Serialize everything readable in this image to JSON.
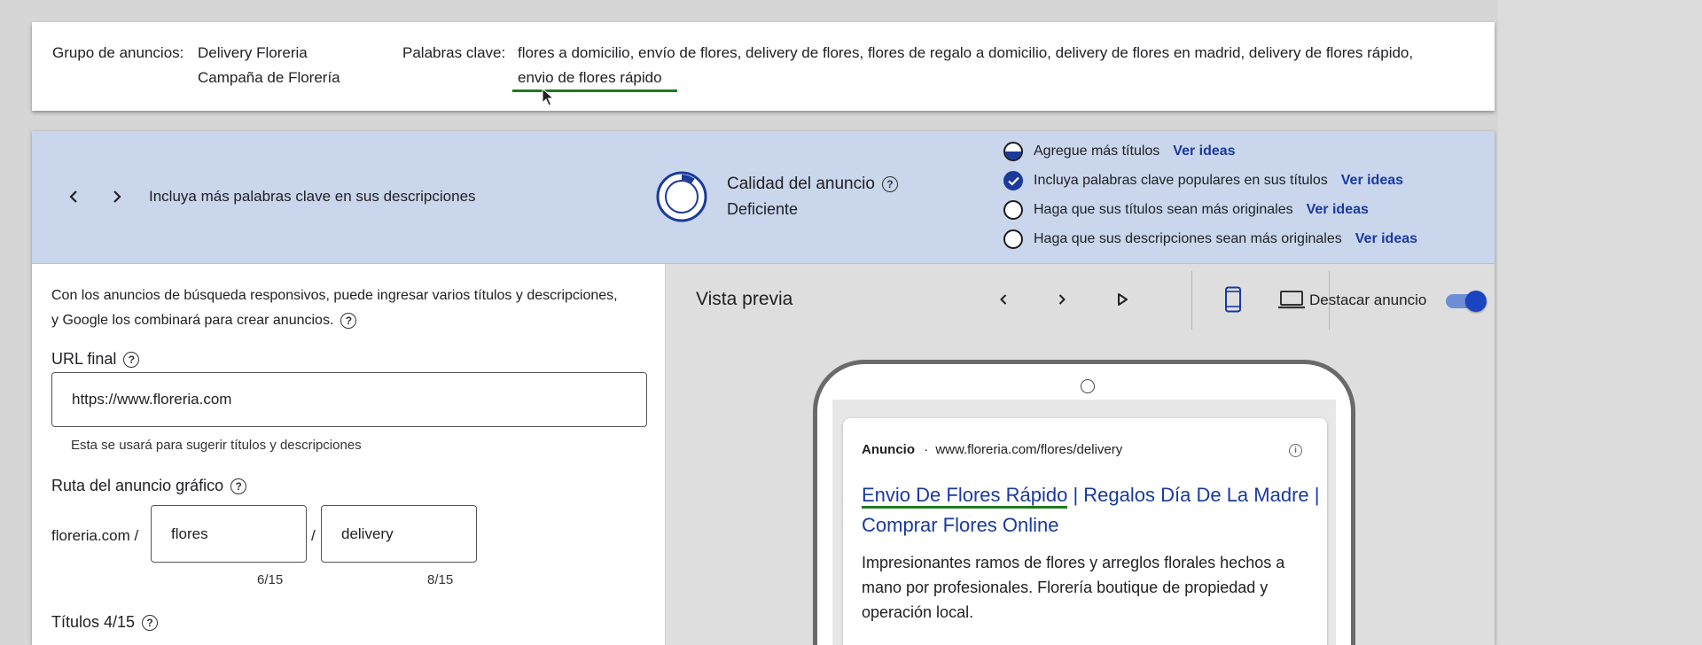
{
  "info": {
    "ad_group_label": "Grupo de anuncios:",
    "ad_group_name": "Delivery Floreria",
    "campaign_name": "Campaña de Florería",
    "keywords_label": "Palabras clave:",
    "keywords_line1": "flores a domicilio, envío de flores, delivery de flores, flores de regalo a domicilio, delivery de flores en madrid, delivery de flores rápido,",
    "keywords_line2": "envio de flores rápido"
  },
  "quality": {
    "tip": "Incluya más palabras clave en sus descripciones",
    "title": "Calidad del anuncio",
    "value": "Deficiente",
    "progress": 0.1,
    "checklist": [
      {
        "text": "Agregue más títulos",
        "link": "Ver ideas",
        "state": "partial"
      },
      {
        "text": "Incluya palabras clave populares en sus títulos",
        "link": "Ver ideas",
        "state": "done"
      },
      {
        "text": "Haga que sus títulos sean más originales",
        "link": "Ver ideas",
        "state": "todo"
      },
      {
        "text": "Haga que sus descripciones sean más originales",
        "link": "Ver ideas",
        "state": "todo"
      }
    ]
  },
  "form": {
    "intro": "Con los anuncios de búsqueda responsivos, puede ingresar varios títulos y descripciones, y Google los combinará para crear anuncios.",
    "final_url_label": "URL final",
    "final_url_value": "https://www.floreria.com",
    "final_url_hint": "Esta se usará para sugerir títulos y descripciones",
    "display_path_label": "Ruta del anuncio gráfico",
    "path_prefix": "floreria.com /",
    "path_separator": "/",
    "path1_value": "flores",
    "path1_count": "6/15",
    "path2_value": "delivery",
    "path2_count": "8/15",
    "headlines_label": "Títulos 4/15"
  },
  "preview": {
    "title": "Vista previa",
    "highlight_label": "Destacar anuncio",
    "highlight_on": true,
    "ad": {
      "sponsored_label": "Anuncio",
      "separator": "·",
      "display_url": "www.floreria.com/flores/delivery",
      "headline_part1": "Envio De Flores Rápido",
      "headline_rest": " | Regalos Día De La Madre | Comprar Flores Online",
      "description": "Impresionantes ramos de flores y arreglos florales hechos a mano por profesionales. Florería boutique de propiedad y operación local."
    }
  },
  "colors": {
    "accent": "#1a3a9c",
    "quality_bar_bg": "#c9d6ec",
    "annotation_green": "#1e7a1e",
    "toggle_on": "#1a44c0"
  },
  "icons": {
    "prev": "chevron-left-icon",
    "next": "chevron-right-icon",
    "play": "play-icon",
    "mobile": "mobile-device-icon",
    "desktop": "laptop-icon",
    "help": "help-circle-icon",
    "info": "info-icon"
  }
}
